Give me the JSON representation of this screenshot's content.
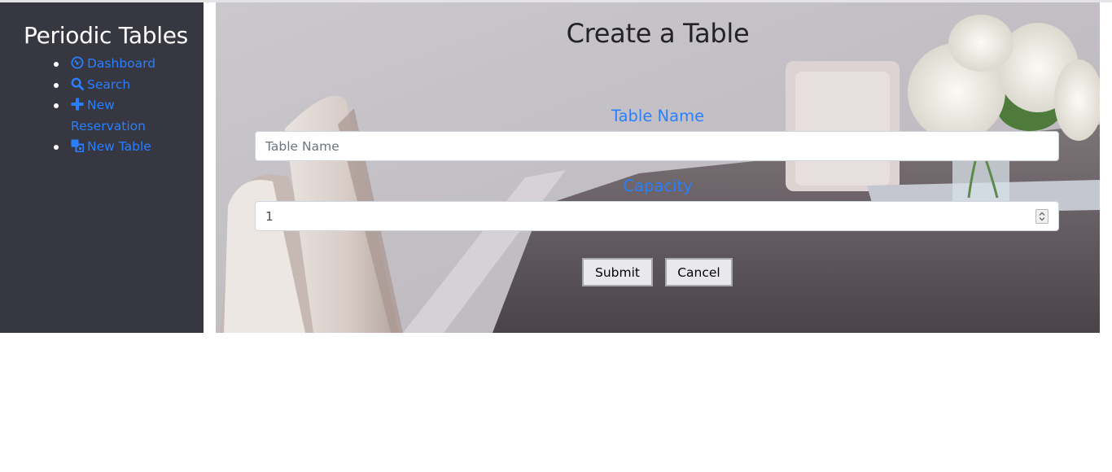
{
  "sidebar": {
    "brand": "Periodic Tables",
    "items": [
      {
        "label": "Dashboard",
        "icon": "dashboard-icon"
      },
      {
        "label": "Search",
        "icon": "search-icon"
      },
      {
        "label": "New Reservation",
        "icon": "plus-icon"
      },
      {
        "label": "New Table",
        "icon": "layers-icon"
      }
    ]
  },
  "main": {
    "title": "Create a Table",
    "table_name": {
      "label": "Table Name",
      "placeholder": "Table Name",
      "value": ""
    },
    "capacity": {
      "label": "Capacity",
      "value": "1"
    },
    "submit_label": "Submit",
    "cancel_label": "Cancel"
  },
  "colors": {
    "sidebar_bg": "#373741",
    "link": "#2a7fff",
    "title_text": "#222228",
    "button_bg": "#e9e9ed"
  }
}
